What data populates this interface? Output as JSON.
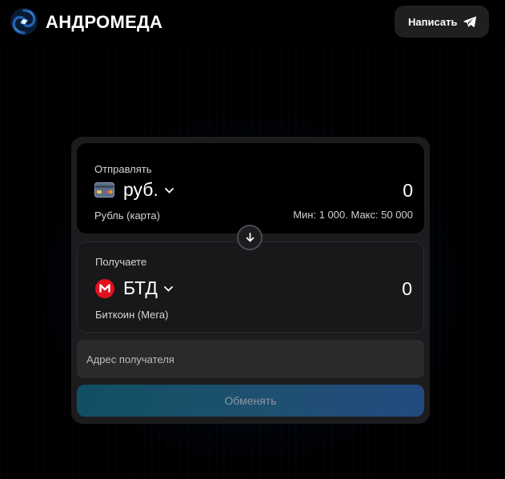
{
  "header": {
    "brand": "АНДРОМЕДА",
    "logo_icon": "spiral-galaxy-icon",
    "write_button_label": "Написать",
    "write_button_icon": "telegram-plane-icon"
  },
  "exchange": {
    "send": {
      "label": "Отправлять",
      "currency_code": "руб.",
      "currency_name": "Рубль (карта)",
      "currency_icon": "bank-card-icon",
      "amount": "0",
      "limits": "Мин: 1 000. Макс: 50 000"
    },
    "swap_icon": "arrow-down-icon",
    "receive": {
      "label": "Получаете",
      "currency_code": "БТД",
      "currency_name": "Биткоин (Мега)",
      "currency_icon": "mega-logo-icon",
      "amount": "0"
    },
    "address_placeholder": "Адрес получателя",
    "submit_label": "Обменять"
  },
  "colors": {
    "background": "#000000",
    "card": "#1c1c1f",
    "mega_red": "#e3101e",
    "button_gradient_start": "#114f63",
    "button_gradient_end": "#234a80"
  }
}
